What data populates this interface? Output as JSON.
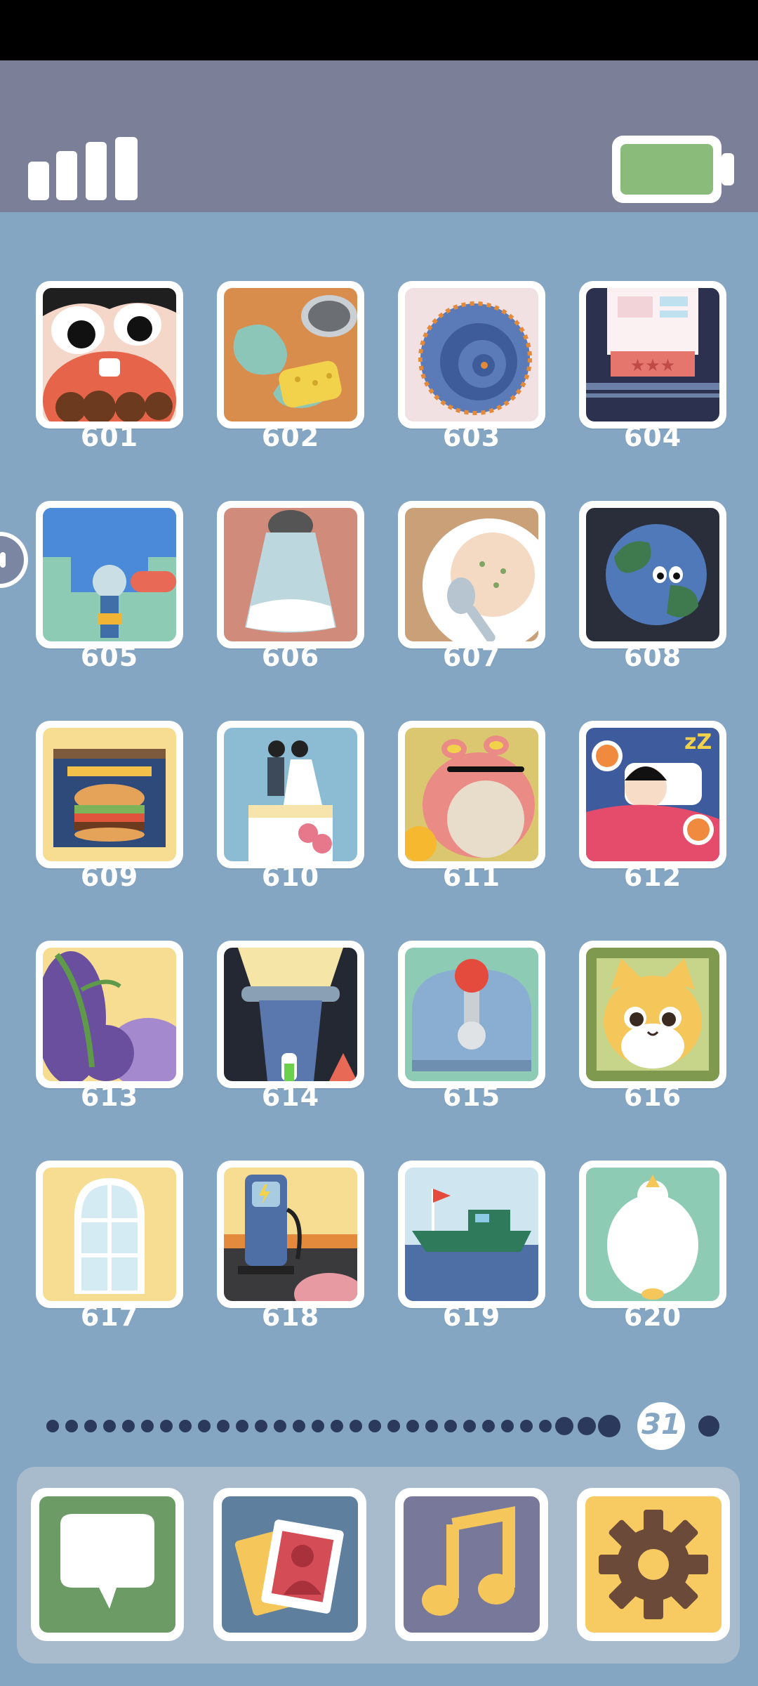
{
  "status": {
    "signal_icon": "signal-bars-icon",
    "battery_icon": "battery-icon",
    "battery_color": "#8bbb7b"
  },
  "levels": [
    {
      "number": "601",
      "icon": "screaming-face-icon"
    },
    {
      "number": "602",
      "icon": "spilled-mug-sponge-icon"
    },
    {
      "number": "603",
      "icon": "ammonite-shell-icon"
    },
    {
      "number": "604",
      "icon": "printer-machine-icon"
    },
    {
      "number": "605",
      "icon": "razor-shaving-icon"
    },
    {
      "number": "606",
      "icon": "salt-shaker-icon"
    },
    {
      "number": "607",
      "icon": "porridge-bowl-icon"
    },
    {
      "number": "608",
      "icon": "earth-planet-icon"
    },
    {
      "number": "609",
      "icon": "burger-box-icon"
    },
    {
      "number": "610",
      "icon": "wedding-cake-icon"
    },
    {
      "number": "611",
      "icon": "pink-frog-icon"
    },
    {
      "number": "612",
      "icon": "sleeping-alarm-icon"
    },
    {
      "number": "613",
      "icon": "eggplant-leaf-icon"
    },
    {
      "number": "614",
      "icon": "spotlight-icon"
    },
    {
      "number": "615",
      "icon": "joystick-machine-icon"
    },
    {
      "number": "616",
      "icon": "tabby-cat-icon"
    },
    {
      "number": "617",
      "icon": "arched-window-icon"
    },
    {
      "number": "618",
      "icon": "fuel-pump-icon"
    },
    {
      "number": "619",
      "icon": "fishing-boat-icon"
    },
    {
      "number": "620",
      "icon": "white-duck-icon"
    }
  ],
  "pager": {
    "current_page": "31",
    "dot_color": "#2b3a5c",
    "highlight_color": "#ffffff"
  },
  "dock": [
    {
      "name": "messages",
      "icon": "speech-bubble-icon",
      "color": "#6c9b66"
    },
    {
      "name": "photos",
      "icon": "photo-cards-icon",
      "color": "#5e7f9e"
    },
    {
      "name": "music",
      "icon": "music-note-icon",
      "color": "#77789a"
    },
    {
      "name": "settings",
      "icon": "gear-icon",
      "color": "#f7cb62"
    }
  ]
}
